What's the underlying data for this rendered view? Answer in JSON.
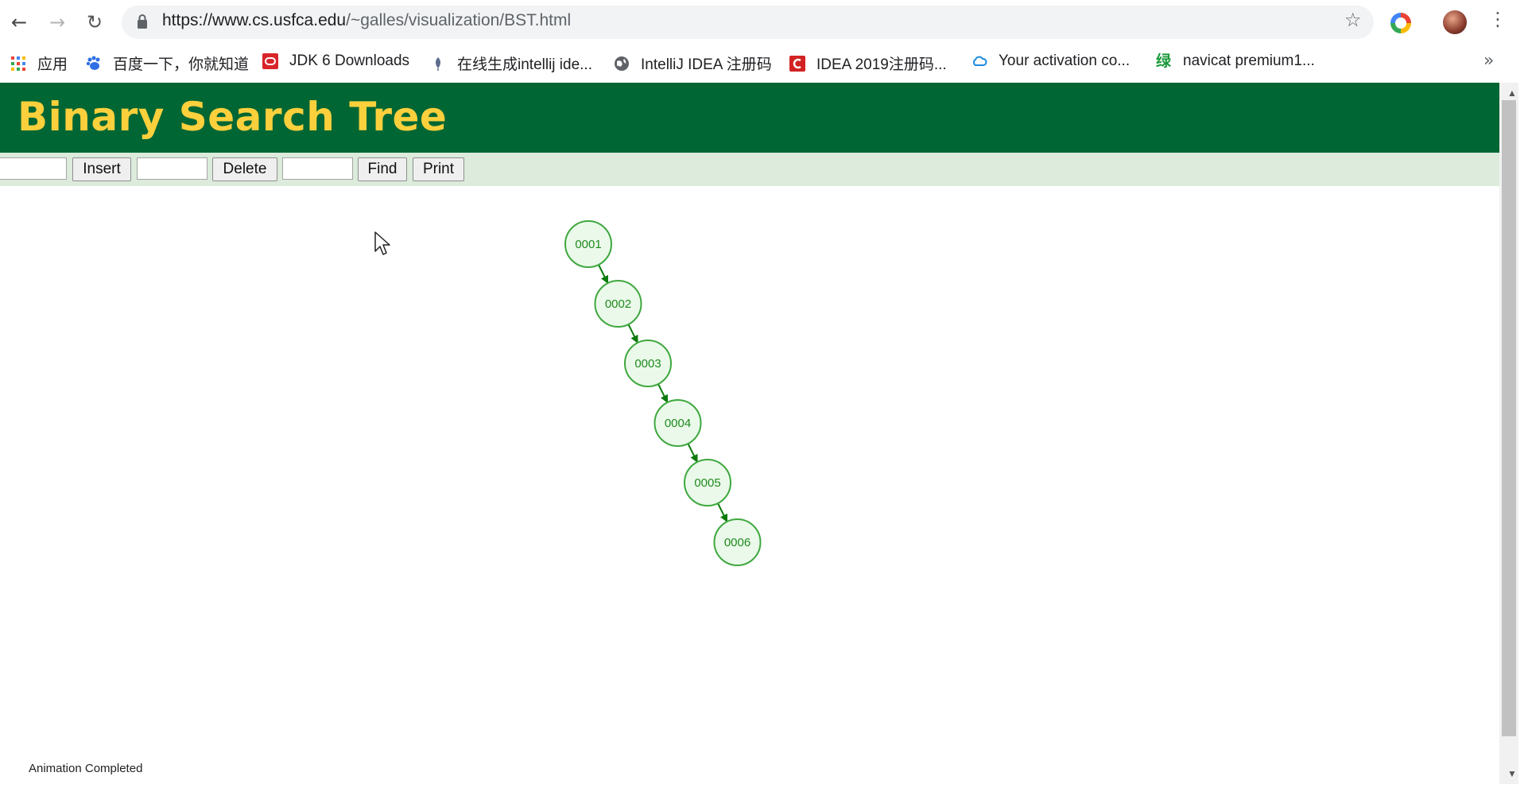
{
  "browser": {
    "url_host": "https://www.cs.usfca.edu",
    "url_path": "/~galles/visualization/BST.html",
    "bookmarks": [
      {
        "label": "应用",
        "icon": "apps-grid-icon"
      },
      {
        "label": "百度一下，你就知道",
        "icon": "baidu-paw-icon"
      },
      {
        "label": "JDK 6 Downloads",
        "icon": "oracle-icon"
      },
      {
        "label": "在线生成intellij ide...",
        "icon": "feather-icon"
      },
      {
        "label": "IntelliJ IDEA 注册码",
        "icon": "globe-icon"
      },
      {
        "label": "IDEA 2019注册码...",
        "icon": "csdn-icon"
      },
      {
        "label": "Your activation co...",
        "icon": "cloud-icon"
      },
      {
        "label": "navicat premium1...",
        "icon": "green-char-icon"
      }
    ],
    "more_label": "»"
  },
  "page": {
    "title": "Binary Search Tree",
    "controls": {
      "insert_label": "Insert",
      "delete_label": "Delete",
      "find_label": "Find",
      "print_label": "Print"
    },
    "tree_nodes": [
      "0001",
      "0002",
      "0003",
      "0004",
      "0005",
      "0006"
    ],
    "status": "Animation Completed"
  },
  "colors": {
    "header_bg": "#006633",
    "title": "#fcd03c",
    "controls_bg": "#dcebdc",
    "node_fill": "#ebf9ea",
    "node_stroke": "#3fa83f",
    "node_text": "#1e8a1e",
    "edge": "#0a7a0a"
  }
}
